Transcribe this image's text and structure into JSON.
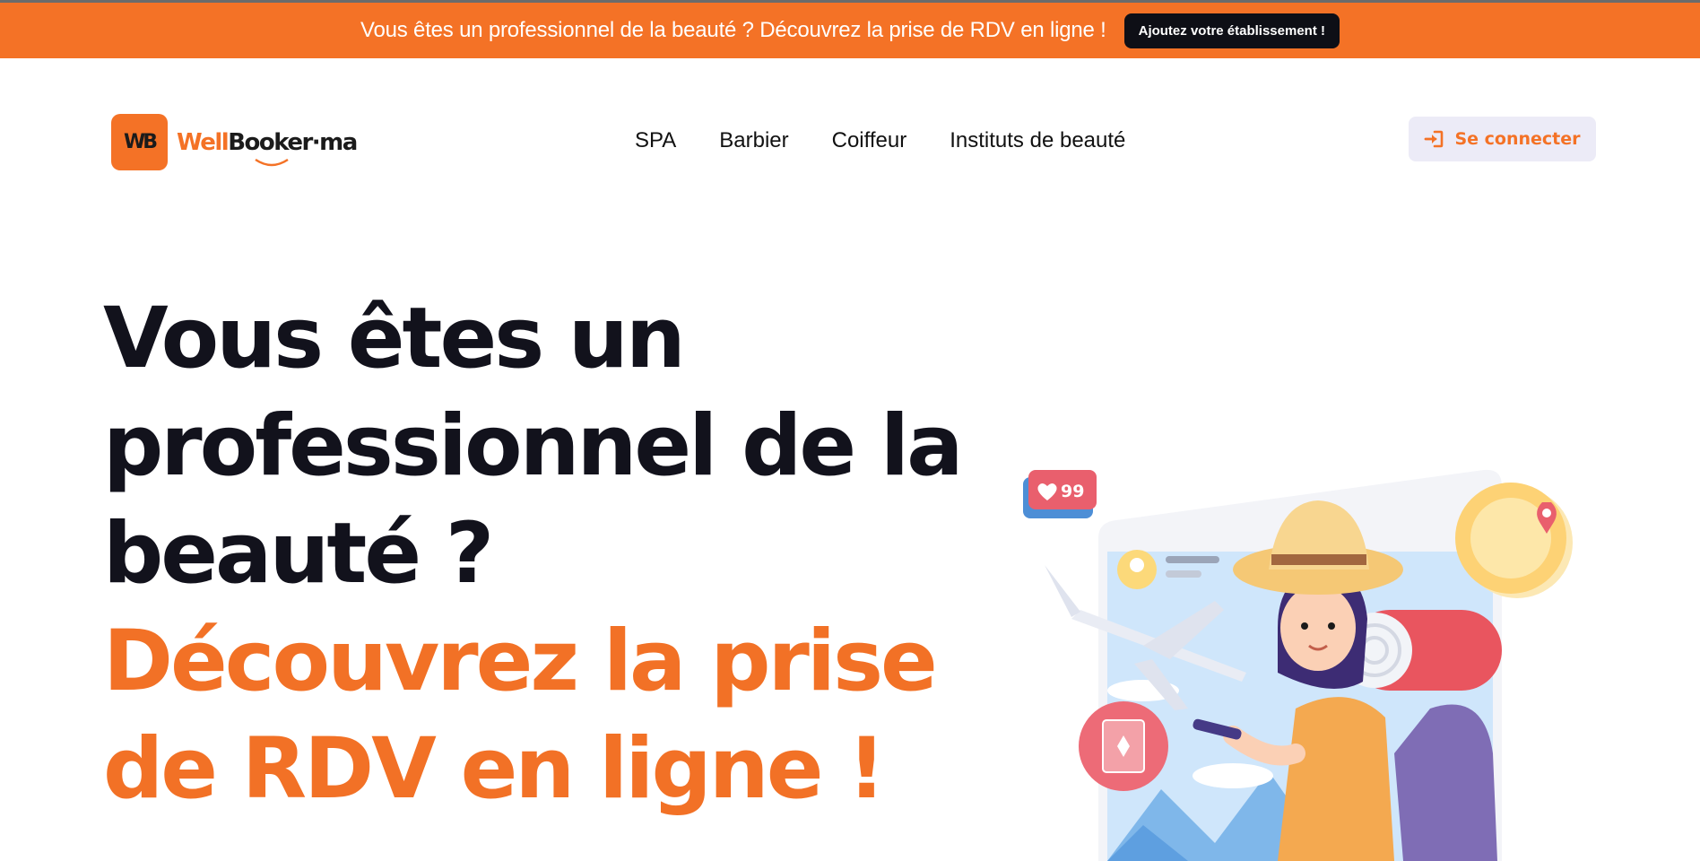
{
  "announcement": {
    "text": "Vous êtes un professionnel de la beauté ? Découvrez la prise de RDV en ligne !",
    "button": "Ajoutez votre établissement !"
  },
  "logo": {
    "badge": "WB",
    "word_orange": "Well",
    "word_dark": "Booker·ma"
  },
  "nav": {
    "items": [
      "SPA",
      "Barbier",
      "Coiffeur",
      "Instituts de beauté"
    ]
  },
  "login": {
    "label": "Se connecter",
    "icon": "sign-in-icon"
  },
  "hero": {
    "dark_lines": [
      "Vous êtes un",
      "professionnel de la",
      "beauté ?"
    ],
    "orange_lines": [
      "Découvrez la prise",
      "de RDV en ligne !"
    ]
  },
  "illustration": {
    "likes": "99"
  },
  "colors": {
    "brand_orange": "#f47226",
    "dark": "#12121c",
    "button_bg": "#ecebf7"
  }
}
